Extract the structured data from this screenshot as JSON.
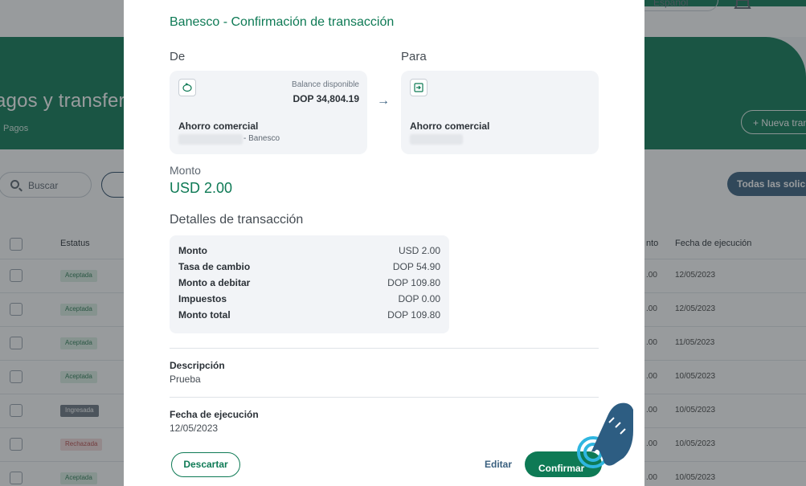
{
  "background": {
    "language": "Español",
    "page_title": "agos y transfere",
    "breadcrumb": "Pagos",
    "new_button": "+ Nueva tran",
    "search_placeholder": "Buscar",
    "all_requests_button": "Todas las solicitu",
    "table": {
      "headers": {
        "status": "Estatus",
        "amount": "nto",
        "execution_date": "Fecha de ejecución"
      },
      "rows": [
        {
          "status": "Aceptada",
          "amount": ".00",
          "date": "12/05/2023",
          "kind": "ok"
        },
        {
          "status": "Aceptada",
          "amount": ".00",
          "date": "12/05/2023",
          "kind": "ok"
        },
        {
          "status": "Aceptada",
          "amount": ".00",
          "date": "11/05/2023",
          "kind": "ok"
        },
        {
          "status": "Aceptada",
          "amount": ".00",
          "date": "10/05/2023",
          "kind": "ok"
        },
        {
          "status": "Ingresada",
          "amount": ".00",
          "date": "10/05/2023",
          "kind": "in"
        },
        {
          "status": "Rechazada",
          "amount": ".00",
          "date": "10/05/2023",
          "kind": "rej"
        },
        {
          "status": "Aceptada",
          "amount": ".00",
          "date": "10/05/2023",
          "kind": "ok"
        }
      ]
    }
  },
  "modal": {
    "title": "Banesco - Confirmación de transacción",
    "from": {
      "label": "De",
      "icon": "piggy-bank-icon",
      "balance_label": "Balance disponible",
      "balance_value": "DOP 34,804.19",
      "account_name": "Ahorro comercial",
      "bank": "- Banesco"
    },
    "to": {
      "label": "Para",
      "icon": "transfer-in-icon",
      "account_name": "Ahorro comercial"
    },
    "amount": {
      "label": "Monto",
      "value": "USD 2.00"
    },
    "details": {
      "title": "Detalles de transacción",
      "rows": [
        {
          "key": "Monto",
          "value": "USD 2.00"
        },
        {
          "key": "Tasa de cambio",
          "value": "DOP 54.90"
        },
        {
          "key": "Monto a debitar",
          "value": "DOP 109.80"
        },
        {
          "key": "Impuestos",
          "value": "DOP 0.00"
        },
        {
          "key": "Monto total",
          "value": "DOP 109.80"
        }
      ]
    },
    "description": {
      "label": "Descripción",
      "value": "Prueba"
    },
    "execution_date": {
      "label": "Fecha de ejecución",
      "value": "12/05/2023"
    },
    "buttons": {
      "discard": "Descartar",
      "edit": "Editar",
      "confirm": "Confirmar"
    }
  },
  "colors": {
    "brand_green": "#0e7a55",
    "link_blue": "#3a607f",
    "hand_blue": "#2d5d82",
    "ring_cyan": "#2fb6e0"
  }
}
